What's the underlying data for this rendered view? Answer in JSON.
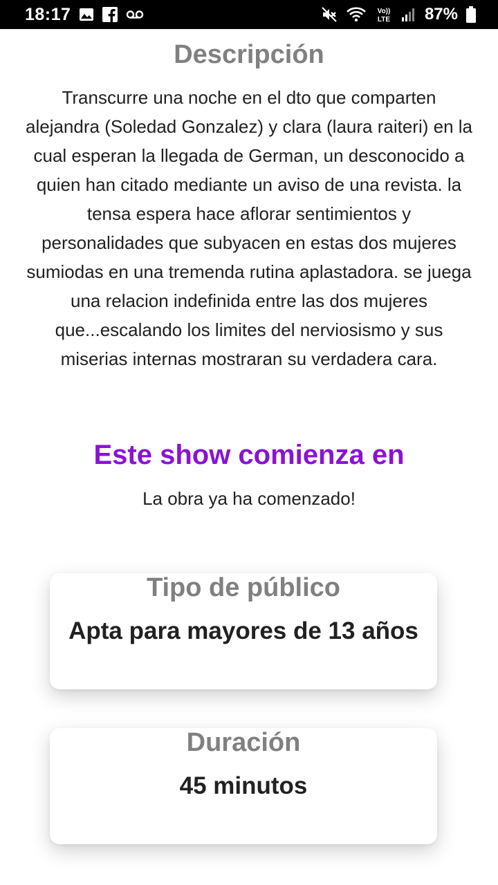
{
  "status_bar": {
    "time": "18:17",
    "battery": "87%",
    "left_icons": [
      "image-icon",
      "facebook-icon",
      "voicemail-icon"
    ],
    "right_icons": [
      "mute-icon",
      "wifi-icon",
      "volte-icon",
      "signal-icon",
      "battery-icon"
    ],
    "volte_label_top": "Vo))",
    "volte_label_bottom": "LTE"
  },
  "description": {
    "heading": "Descripción",
    "text": "Transcurre una noche en el dto que comparten alejandra (Soledad Gonzalez) y clara (laura raiteri) en la cual esperan la llegada de German, un desconocido a quien han citado mediante un aviso de una revista. la tensa espera hace aflorar sentimientos y personalidades que subyacen en estas dos mujeres sumiodas en una tremenda rutina aplastadora. se juega una relacion indefinida entre las dos mujeres que...escalando los limites del nerviosismo y sus miserias internas mostraran su verdadera cara."
  },
  "show": {
    "heading": "Este show comienza en",
    "status": "La obra ya ha comenzado!"
  },
  "cards": [
    {
      "title": "Tipo de público",
      "value": "Apta para mayores de 13 años"
    },
    {
      "title": "Duración",
      "value": "45 minutos"
    }
  ],
  "colors": {
    "accent": "#8a12d6",
    "heading_gray": "#808080",
    "text": "#212121"
  }
}
